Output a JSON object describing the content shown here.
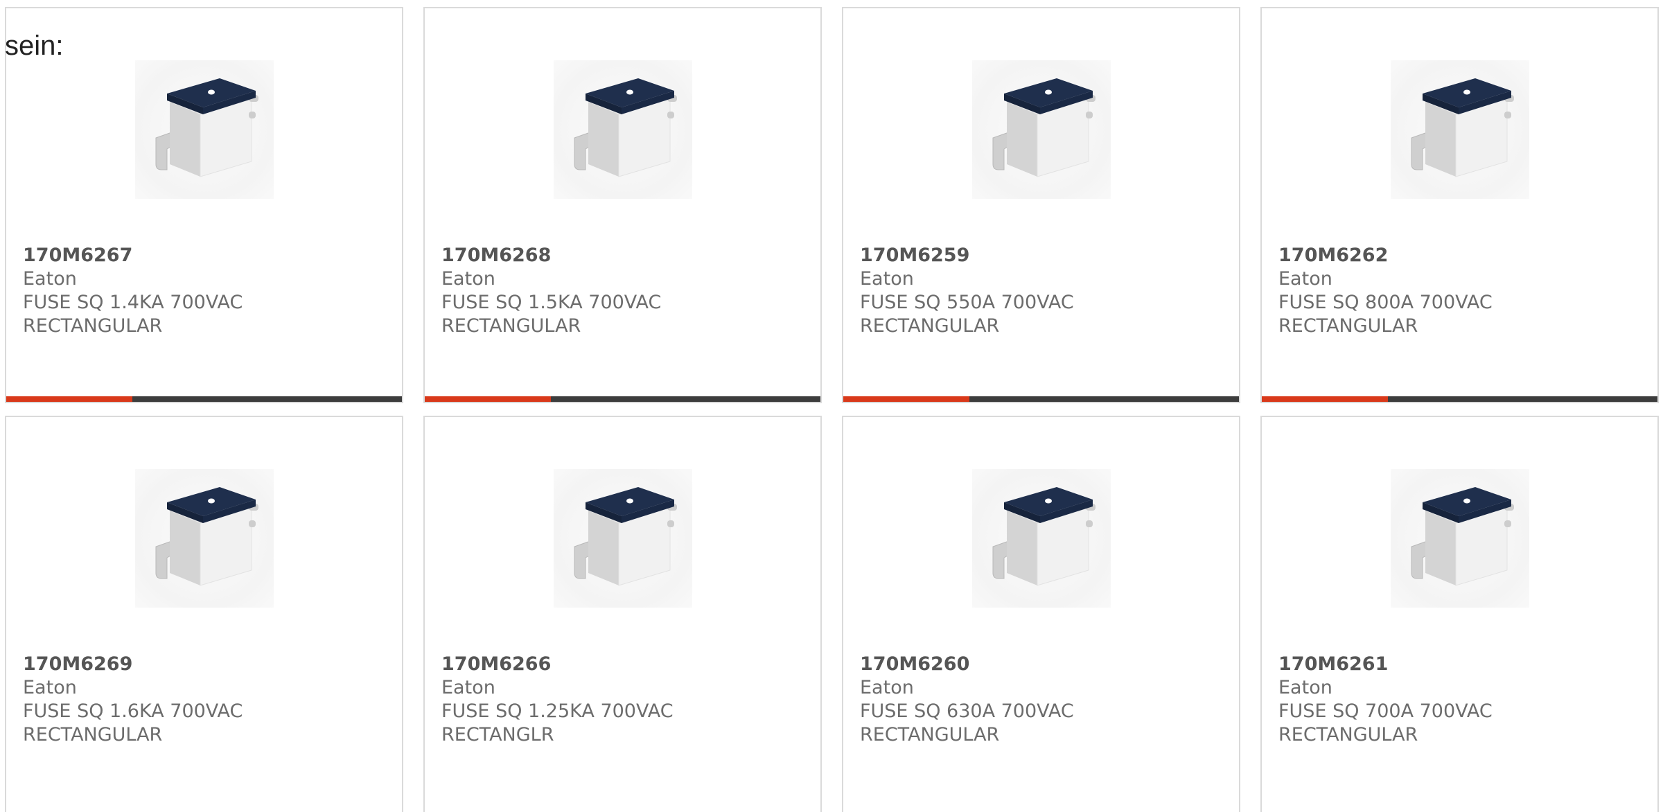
{
  "intro_text": "sein:",
  "colors": {
    "accent": "#d9391a",
    "bar": "#3d3d3d",
    "border": "#dadada",
    "text": "#6c6c6c"
  },
  "products": [
    {
      "part_number": "170M6267",
      "manufacturer": "Eaton",
      "description_line1": "FUSE SQ 1.4KA 700VAC",
      "description_line2": "RECTANGULAR"
    },
    {
      "part_number": "170M6268",
      "manufacturer": "Eaton",
      "description_line1": "FUSE SQ 1.5KA 700VAC",
      "description_line2": "RECTANGULAR"
    },
    {
      "part_number": "170M6259",
      "manufacturer": "Eaton",
      "description_line1": "FUSE SQ 550A 700VAC",
      "description_line2": "RECTANGULAR"
    },
    {
      "part_number": "170M6262",
      "manufacturer": "Eaton",
      "description_line1": "FUSE SQ 800A 700VAC",
      "description_line2": "RECTANGULAR"
    },
    {
      "part_number": "170M6269",
      "manufacturer": "Eaton",
      "description_line1": "FUSE SQ 1.6KA 700VAC",
      "description_line2": "RECTANGULAR"
    },
    {
      "part_number": "170M6266",
      "manufacturer": "Eaton",
      "description_line1": "FUSE SQ 1.25KA 700VAC",
      "description_line2": "RECTANGLR"
    },
    {
      "part_number": "170M6260",
      "manufacturer": "Eaton",
      "description_line1": "FUSE SQ 630A 700VAC",
      "description_line2": "RECTANGULAR"
    },
    {
      "part_number": "170M6261",
      "manufacturer": "Eaton",
      "description_line1": "FUSE SQ 700A 700VAC",
      "description_line2": "RECTANGULAR"
    }
  ]
}
